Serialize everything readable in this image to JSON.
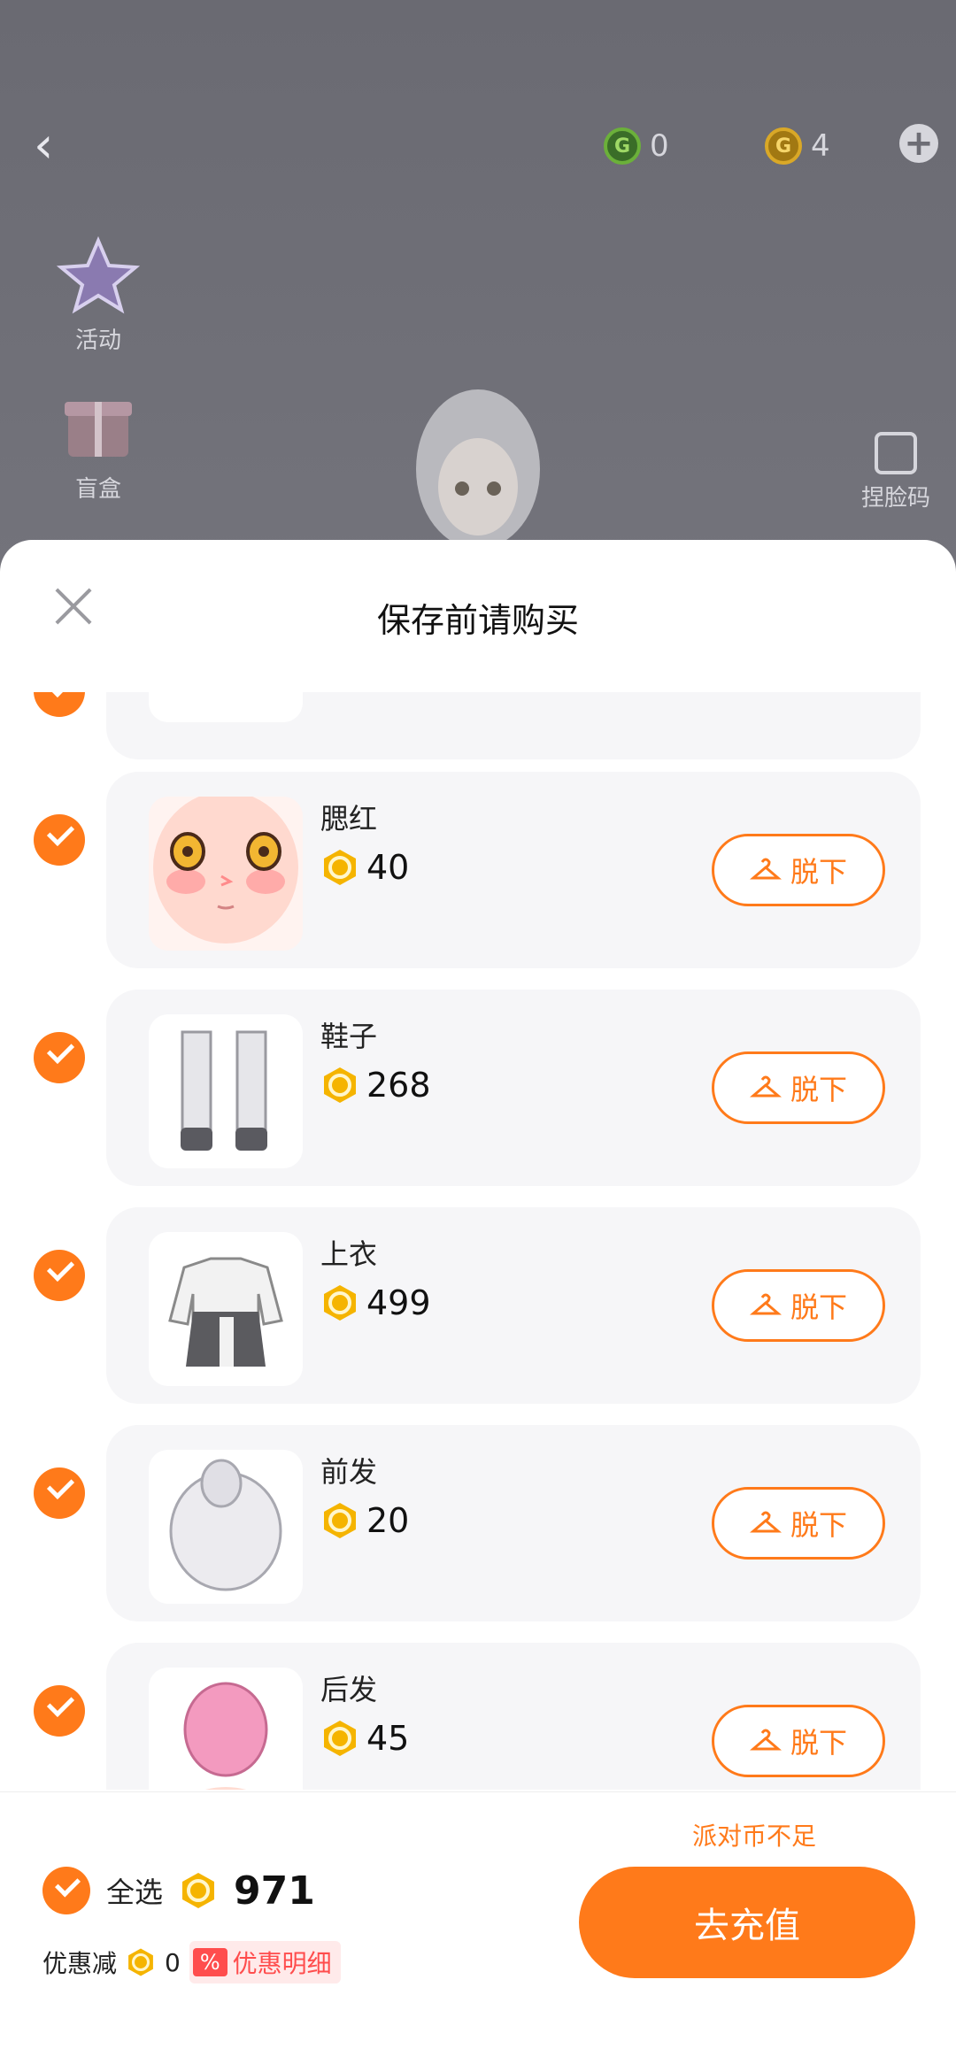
{
  "top_bar": {
    "green_coin_value": "0",
    "gold_coin_value": "4"
  },
  "side_menu": [
    {
      "label": "活动"
    },
    {
      "label": "盲盒"
    }
  ],
  "face_code_label": "捏脸码",
  "sheet": {
    "title": "保存前请购买",
    "items": [
      {
        "name": "腮红",
        "price": "40",
        "action": "脱下"
      },
      {
        "name": "鞋子",
        "price": "268",
        "action": "脱下"
      },
      {
        "name": "上衣",
        "price": "499",
        "action": "脱下"
      },
      {
        "name": "前发",
        "price": "20",
        "action": "脱下"
      },
      {
        "name": "后发",
        "price": "45",
        "action": "脱下"
      }
    ]
  },
  "footer": {
    "insufficient_notice": "派对币不足",
    "select_all_label": "全选",
    "total": "971",
    "discount_label": "优惠减",
    "discount_value": "0",
    "discount_detail": "优惠明细",
    "discount_tag": "%",
    "recharge_button": "去充值"
  },
  "colors": {
    "accent": "#ff7a1a",
    "discount": "#ff4d4d"
  }
}
